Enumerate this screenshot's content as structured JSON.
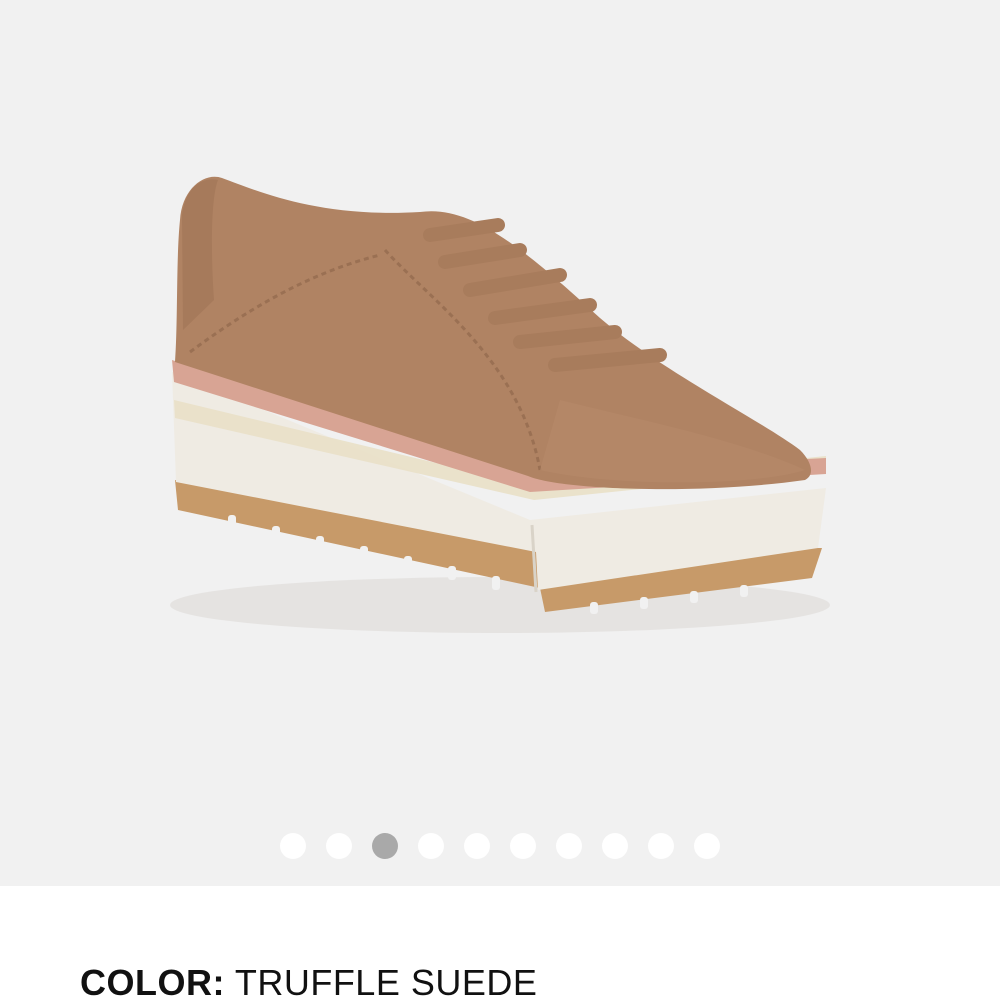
{
  "gallery": {
    "image_alt": "Truffle suede platform lace-up sneaker",
    "slide_count": 10,
    "active_index": 2
  },
  "product": {
    "color_label": "COLOR:",
    "color_value": "TRUFFLE SUEDE"
  },
  "colors": {
    "background": "#f1f1f1",
    "dot_inactive": "#ffffff",
    "dot_active": "#a9a9a9",
    "suede": "#b08363",
    "sole": "#f0ece3",
    "outsole": "#c79a69",
    "welt": "#d8a494"
  }
}
